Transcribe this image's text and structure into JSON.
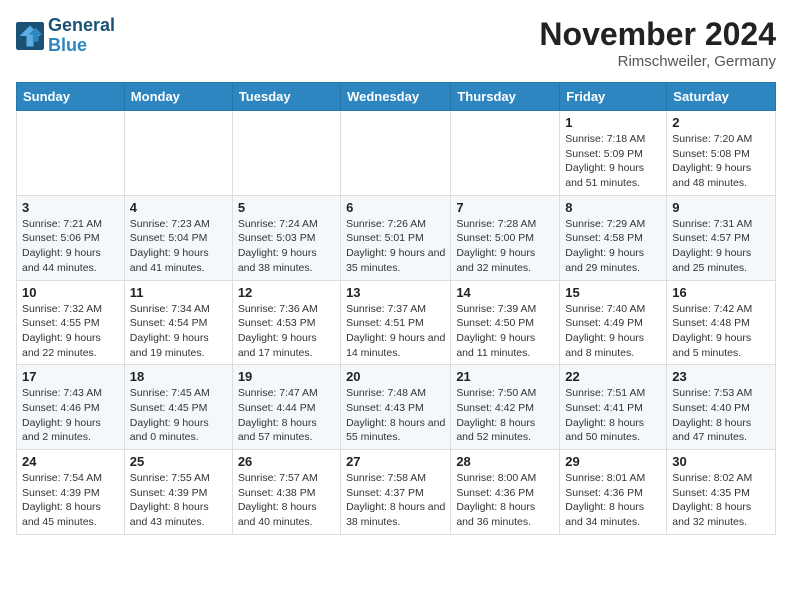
{
  "logo": {
    "line1": "General",
    "line2": "Blue"
  },
  "title": "November 2024",
  "location": "Rimschweiler, Germany",
  "weekdays": [
    "Sunday",
    "Monday",
    "Tuesday",
    "Wednesday",
    "Thursday",
    "Friday",
    "Saturday"
  ],
  "weeks": [
    [
      {
        "day": "",
        "info": ""
      },
      {
        "day": "",
        "info": ""
      },
      {
        "day": "",
        "info": ""
      },
      {
        "day": "",
        "info": ""
      },
      {
        "day": "",
        "info": ""
      },
      {
        "day": "1",
        "info": "Sunrise: 7:18 AM\nSunset: 5:09 PM\nDaylight: 9 hours and 51 minutes."
      },
      {
        "day": "2",
        "info": "Sunrise: 7:20 AM\nSunset: 5:08 PM\nDaylight: 9 hours and 48 minutes."
      }
    ],
    [
      {
        "day": "3",
        "info": "Sunrise: 7:21 AM\nSunset: 5:06 PM\nDaylight: 9 hours and 44 minutes."
      },
      {
        "day": "4",
        "info": "Sunrise: 7:23 AM\nSunset: 5:04 PM\nDaylight: 9 hours and 41 minutes."
      },
      {
        "day": "5",
        "info": "Sunrise: 7:24 AM\nSunset: 5:03 PM\nDaylight: 9 hours and 38 minutes."
      },
      {
        "day": "6",
        "info": "Sunrise: 7:26 AM\nSunset: 5:01 PM\nDaylight: 9 hours and 35 minutes."
      },
      {
        "day": "7",
        "info": "Sunrise: 7:28 AM\nSunset: 5:00 PM\nDaylight: 9 hours and 32 minutes."
      },
      {
        "day": "8",
        "info": "Sunrise: 7:29 AM\nSunset: 4:58 PM\nDaylight: 9 hours and 29 minutes."
      },
      {
        "day": "9",
        "info": "Sunrise: 7:31 AM\nSunset: 4:57 PM\nDaylight: 9 hours and 25 minutes."
      }
    ],
    [
      {
        "day": "10",
        "info": "Sunrise: 7:32 AM\nSunset: 4:55 PM\nDaylight: 9 hours and 22 minutes."
      },
      {
        "day": "11",
        "info": "Sunrise: 7:34 AM\nSunset: 4:54 PM\nDaylight: 9 hours and 19 minutes."
      },
      {
        "day": "12",
        "info": "Sunrise: 7:36 AM\nSunset: 4:53 PM\nDaylight: 9 hours and 17 minutes."
      },
      {
        "day": "13",
        "info": "Sunrise: 7:37 AM\nSunset: 4:51 PM\nDaylight: 9 hours and 14 minutes."
      },
      {
        "day": "14",
        "info": "Sunrise: 7:39 AM\nSunset: 4:50 PM\nDaylight: 9 hours and 11 minutes."
      },
      {
        "day": "15",
        "info": "Sunrise: 7:40 AM\nSunset: 4:49 PM\nDaylight: 9 hours and 8 minutes."
      },
      {
        "day": "16",
        "info": "Sunrise: 7:42 AM\nSunset: 4:48 PM\nDaylight: 9 hours and 5 minutes."
      }
    ],
    [
      {
        "day": "17",
        "info": "Sunrise: 7:43 AM\nSunset: 4:46 PM\nDaylight: 9 hours and 2 minutes."
      },
      {
        "day": "18",
        "info": "Sunrise: 7:45 AM\nSunset: 4:45 PM\nDaylight: 9 hours and 0 minutes."
      },
      {
        "day": "19",
        "info": "Sunrise: 7:47 AM\nSunset: 4:44 PM\nDaylight: 8 hours and 57 minutes."
      },
      {
        "day": "20",
        "info": "Sunrise: 7:48 AM\nSunset: 4:43 PM\nDaylight: 8 hours and 55 minutes."
      },
      {
        "day": "21",
        "info": "Sunrise: 7:50 AM\nSunset: 4:42 PM\nDaylight: 8 hours and 52 minutes."
      },
      {
        "day": "22",
        "info": "Sunrise: 7:51 AM\nSunset: 4:41 PM\nDaylight: 8 hours and 50 minutes."
      },
      {
        "day": "23",
        "info": "Sunrise: 7:53 AM\nSunset: 4:40 PM\nDaylight: 8 hours and 47 minutes."
      }
    ],
    [
      {
        "day": "24",
        "info": "Sunrise: 7:54 AM\nSunset: 4:39 PM\nDaylight: 8 hours and 45 minutes."
      },
      {
        "day": "25",
        "info": "Sunrise: 7:55 AM\nSunset: 4:39 PM\nDaylight: 8 hours and 43 minutes."
      },
      {
        "day": "26",
        "info": "Sunrise: 7:57 AM\nSunset: 4:38 PM\nDaylight: 8 hours and 40 minutes."
      },
      {
        "day": "27",
        "info": "Sunrise: 7:58 AM\nSunset: 4:37 PM\nDaylight: 8 hours and 38 minutes."
      },
      {
        "day": "28",
        "info": "Sunrise: 8:00 AM\nSunset: 4:36 PM\nDaylight: 8 hours and 36 minutes."
      },
      {
        "day": "29",
        "info": "Sunrise: 8:01 AM\nSunset: 4:36 PM\nDaylight: 8 hours and 34 minutes."
      },
      {
        "day": "30",
        "info": "Sunrise: 8:02 AM\nSunset: 4:35 PM\nDaylight: 8 hours and 32 minutes."
      }
    ]
  ]
}
